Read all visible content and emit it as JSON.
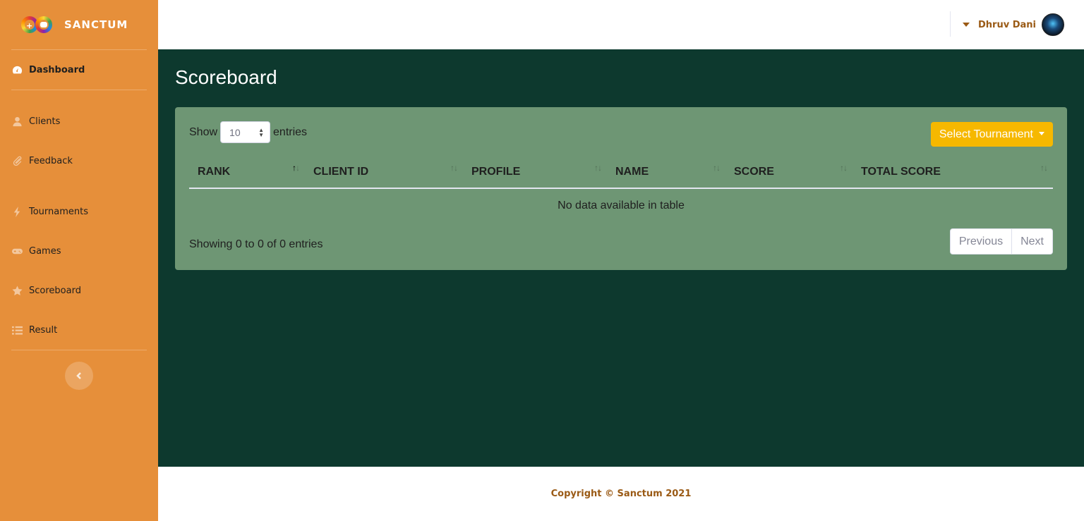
{
  "brand": {
    "name": "SANCTUM"
  },
  "sidebar": {
    "items": [
      {
        "label": "Dashboard",
        "icon": "tachometer-icon"
      },
      {
        "label": "Clients",
        "icon": "user-icon"
      },
      {
        "label": "Feedback",
        "icon": "paperclip-icon"
      },
      {
        "label": "Tournaments",
        "icon": "bolt-icon"
      },
      {
        "label": "Games",
        "icon": "gamepad-icon"
      },
      {
        "label": "Scoreboard",
        "icon": "star-icon"
      },
      {
        "label": "Result",
        "icon": "list-icon"
      }
    ],
    "active": "Dashboard"
  },
  "topbar": {
    "user_name": "Dhruv Dani"
  },
  "page": {
    "title": "Scoreboard"
  },
  "table_controls": {
    "show_label": "Show",
    "entries_value": "10",
    "entries_label": "entries",
    "tournament_button": "Select Tournament"
  },
  "table": {
    "columns": [
      "RANK",
      "CLIENT ID",
      "PROFILE",
      "NAME",
      "SCORE",
      "TOTAL SCORE"
    ],
    "empty_message": "No data available in table",
    "info": "Showing 0 to 0 of 0 entries"
  },
  "pagination": {
    "previous": "Previous",
    "next": "Next"
  },
  "footer": {
    "copyright": "Copyright © Sanctum 2021"
  },
  "colors": {
    "sidebar_bg": "#e68f3a",
    "main_bg": "#0d392e",
    "card_bg": "#6e9674",
    "accent_button": "#f6b800",
    "brown_text": "#9a5a15"
  }
}
